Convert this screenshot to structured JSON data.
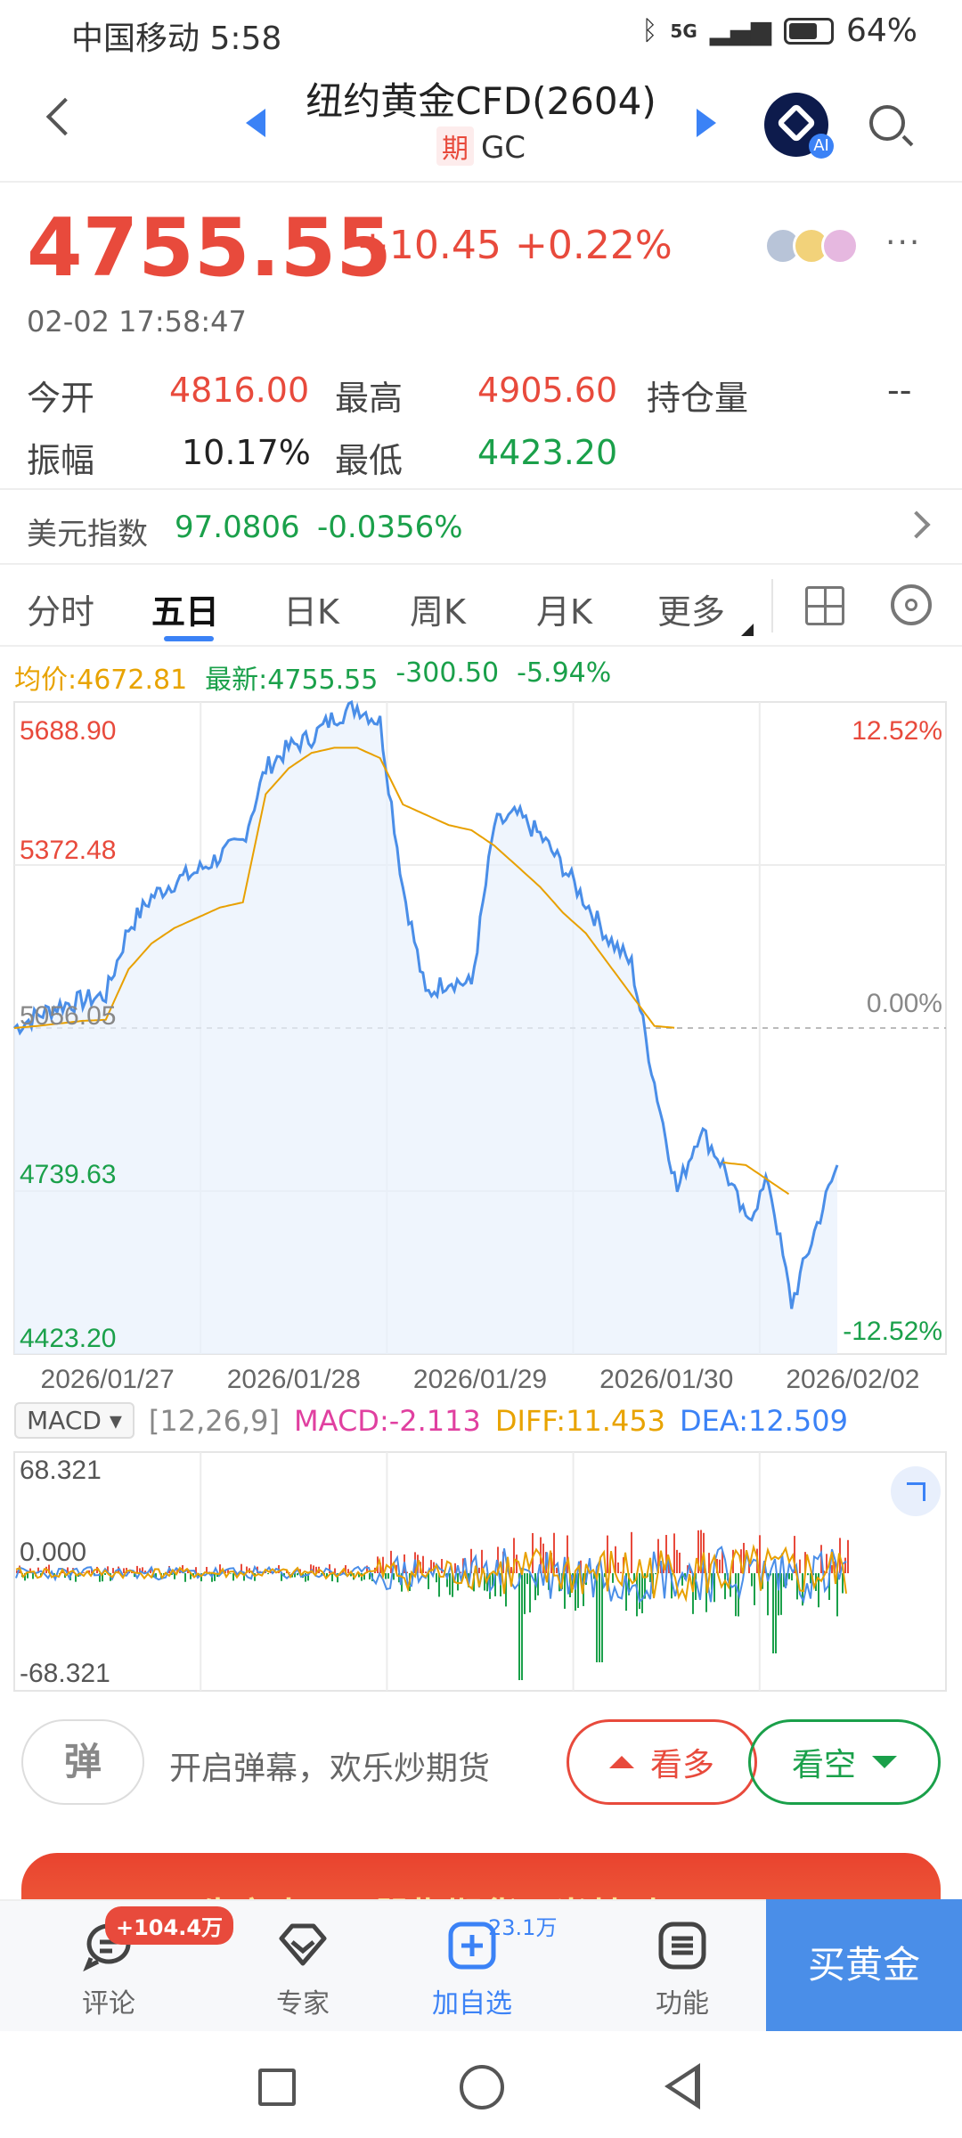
{
  "status_bar": {
    "carrier_time": "中国移动 5:58",
    "network": "5G",
    "battery": "64%"
  },
  "header": {
    "title": "纽约黄金CFD(2604)",
    "tag": "期",
    "code": "GC"
  },
  "quote": {
    "price": "4755.55",
    "change": "+10.45",
    "change_pct": "+0.22%",
    "timestamp": "02-02 17:58:47",
    "open_label": "今开",
    "open": "4816.00",
    "high_label": "最高",
    "high": "4905.60",
    "oi_label": "持仓量",
    "oi": "--",
    "amp_label": "振幅",
    "amp": "10.17%",
    "low_label": "最低",
    "low": "4423.20"
  },
  "usd_index": {
    "label": "美元指数",
    "value": "97.0806",
    "change": "-0.0356%"
  },
  "tabs": [
    "分时",
    "五日",
    "日K",
    "周K",
    "月K",
    "更多"
  ],
  "chart_info": {
    "avg": "均价:4672.81",
    "latest": "最新:4755.55",
    "chg": "-300.50",
    "pct": "-5.94%"
  },
  "chart_data": [
    {
      "type": "line",
      "x": [
        "2026/01/27",
        "2026/01/28",
        "2026/01/29",
        "2026/01/30",
        "2026/02/02"
      ],
      "y_ticks": [
        "5688.90",
        "5372.48",
        "5056.05",
        "4739.63",
        "4423.20"
      ],
      "y_pct_ticks": [
        "12.52%",
        "0.00%",
        "-12.52%"
      ],
      "ylim": [
        4423.2,
        5688.9
      ],
      "series": [
        {
          "values": [
            5056.05,
            5080,
            5100,
            5110,
            5120,
            5250,
            5310,
            5340,
            5360,
            5390,
            5420,
            5560,
            5600,
            5620,
            5660,
            5680,
            5650,
            5330,
            5120,
            5150,
            5140,
            5450,
            5470,
            5430,
            5370,
            5300,
            5230,
            5180,
            4950,
            4740,
            4860,
            4790,
            4680,
            4760,
            4520,
            4660,
            4790
          ]
        },
        {
          "values": [
            5056.05,
            5060,
            5065,
            5070,
            5072,
            5170,
            5220,
            5250,
            5270,
            5290,
            5300,
            5510,
            5560,
            5590,
            5600,
            5600,
            5580,
            5490,
            5470,
            5450,
            5440,
            5410,
            5370,
            5330,
            5280,
            5240,
            5180,
            5120,
            5060,
            5056.05,
            null,
            4795,
            4790,
            4760,
            4730,
            null,
            null
          ]
        }
      ]
    },
    {
      "type": "bar",
      "params": "[12,26,9]",
      "macd": "MACD:-2.113",
      "diff": "DIFF:11.453",
      "dea": "DEA:12.509",
      "y_ticks": [
        "68.321",
        "0.000",
        "-68.321"
      ],
      "ylim": [
        -68.321,
        68.321
      ]
    }
  ],
  "macd_select": "MACD",
  "danmu": {
    "icon": "弹",
    "text": "开启弹幕，欢乐炒期货"
  },
  "actions": {
    "bull": "看多",
    "bear": "看空"
  },
  "banner_text": "牛市来了? 股指期货正当其时 →",
  "bottom_nav": [
    {
      "label": "评论",
      "badge": "+104.4万"
    },
    {
      "label": "专家"
    },
    {
      "label": "加自选",
      "badge": "23.1万"
    },
    {
      "label": "功能"
    }
  ],
  "buy_button": "买黄金"
}
